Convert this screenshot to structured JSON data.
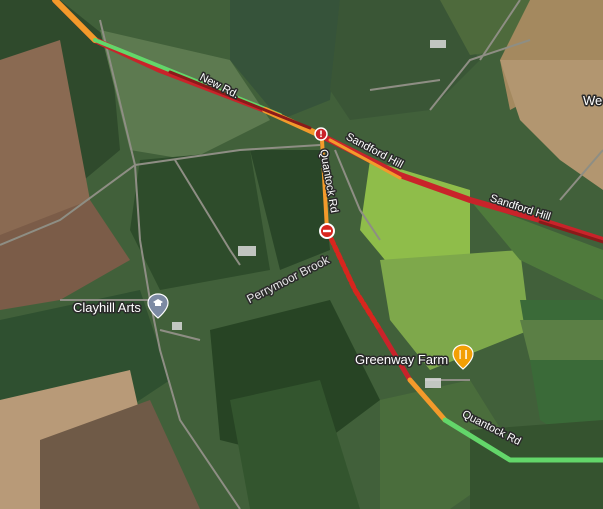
{
  "map": {
    "road_labels": {
      "new_rd": "New Rd.",
      "sandford_hill_1": "Sandford Hill",
      "sandford_hill_2": "Sandford Hill",
      "quantock_rd_1": "Quantock Rd",
      "quantock_rd_2": "Quantock Rd",
      "perrymoor_brook": "Perrymoor Brook",
      "we_partial": "We"
    },
    "pois": {
      "clayhill_arts": "Clayhill Arts",
      "greenway_farm": "Greenway Farm"
    },
    "colors": {
      "traffic_green": "#63d66a",
      "traffic_orange": "#f39a2b",
      "traffic_red": "#c9232a",
      "traffic_dark_red": "#8a1a1a",
      "poi_orange": "#f29f05",
      "poi_gray": "#7c8aa3",
      "closure_red": "#d7261e"
    },
    "icons": {
      "clayhill_arts": "graduation-cap-icon",
      "greenway_farm": "fork-knife-icon",
      "closure": "no-entry-icon",
      "junction": "warning-icon"
    }
  }
}
